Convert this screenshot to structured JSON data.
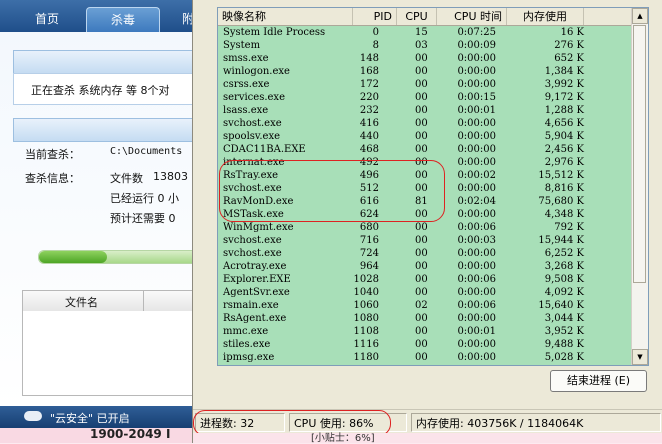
{
  "antivirus": {
    "tabs": [
      "首页",
      "杀毒",
      "附"
    ],
    "scan_status": "正在查杀  系统内存  等 8个对",
    "current_label": "当前查杀：",
    "current_value": "C:\\Documents",
    "info_label": "查杀信息：",
    "files_label": "文件数",
    "files_value": "13803",
    "elapsed": "已经运行 0 小",
    "remaining": "预计还需要 0",
    "progress": 0.42,
    "table_header": "文件名",
    "cloud": "\"云安全\" 已开启",
    "footer_left": "1900-2049 I"
  },
  "taskmgr": {
    "columns": [
      "映像名称",
      "PID",
      "CPU",
      "CPU 时间",
      "内存使用"
    ],
    "processes": [
      {
        "name": "System Idle Process",
        "pid": "0",
        "cpu": "15",
        "time": "0:07:25",
        "mem": "16 K"
      },
      {
        "name": "System",
        "pid": "8",
        "cpu": "03",
        "time": "0:00:09",
        "mem": "276 K"
      },
      {
        "name": "smss.exe",
        "pid": "148",
        "cpu": "00",
        "time": "0:00:00",
        "mem": "652 K"
      },
      {
        "name": "winlogon.exe",
        "pid": "168",
        "cpu": "00",
        "time": "0:00:00",
        "mem": "1,384 K"
      },
      {
        "name": "csrss.exe",
        "pid": "172",
        "cpu": "00",
        "time": "0:00:00",
        "mem": "3,992 K"
      },
      {
        "name": "services.exe",
        "pid": "220",
        "cpu": "00",
        "time": "0:00:15",
        "mem": "9,172 K"
      },
      {
        "name": "lsass.exe",
        "pid": "232",
        "cpu": "00",
        "time": "0:00:01",
        "mem": "1,288 K"
      },
      {
        "name": "svchost.exe",
        "pid": "416",
        "cpu": "00",
        "time": "0:00:00",
        "mem": "4,656 K"
      },
      {
        "name": "spoolsv.exe",
        "pid": "440",
        "cpu": "00",
        "time": "0:00:00",
        "mem": "5,904 K"
      },
      {
        "name": "CDAC11BA.EXE",
        "pid": "468",
        "cpu": "00",
        "time": "0:00:00",
        "mem": "2,456 K"
      },
      {
        "name": "internat.exe",
        "pid": "492",
        "cpu": "00",
        "time": "0:00:00",
        "mem": "2,976 K"
      },
      {
        "name": "RsTray.exe",
        "pid": "496",
        "cpu": "00",
        "time": "0:00:02",
        "mem": "15,512 K"
      },
      {
        "name": "svchost.exe",
        "pid": "512",
        "cpu": "00",
        "time": "0:00:00",
        "mem": "8,816 K"
      },
      {
        "name": "RavMonD.exe",
        "pid": "616",
        "cpu": "81",
        "time": "0:02:04",
        "mem": "75,680 K"
      },
      {
        "name": "MSTask.exe",
        "pid": "624",
        "cpu": "00",
        "time": "0:00:00",
        "mem": "4,348 K"
      },
      {
        "name": "WinMgmt.exe",
        "pid": "680",
        "cpu": "00",
        "time": "0:00:06",
        "mem": "792 K"
      },
      {
        "name": "svchost.exe",
        "pid": "716",
        "cpu": "00",
        "time": "0:00:03",
        "mem": "15,944 K"
      },
      {
        "name": "svchost.exe",
        "pid": "724",
        "cpu": "00",
        "time": "0:00:00",
        "mem": "6,252 K"
      },
      {
        "name": "Acrotray.exe",
        "pid": "964",
        "cpu": "00",
        "time": "0:00:00",
        "mem": "3,268 K"
      },
      {
        "name": "Explorer.EXE",
        "pid": "1028",
        "cpu": "00",
        "time": "0:00:06",
        "mem": "9,508 K"
      },
      {
        "name": "AgentSvr.exe",
        "pid": "1040",
        "cpu": "00",
        "time": "0:00:00",
        "mem": "4,092 K"
      },
      {
        "name": "rsmain.exe",
        "pid": "1060",
        "cpu": "02",
        "time": "0:00:06",
        "mem": "15,640 K"
      },
      {
        "name": "RsAgent.exe",
        "pid": "1080",
        "cpu": "00",
        "time": "0:00:00",
        "mem": "3,044 K"
      },
      {
        "name": "mmc.exe",
        "pid": "1108",
        "cpu": "00",
        "time": "0:00:01",
        "mem": "3,952 K"
      },
      {
        "name": "stiles.exe",
        "pid": "1116",
        "cpu": "00",
        "time": "0:00:00",
        "mem": "9,488 K"
      },
      {
        "name": "ipmsg.exe",
        "pid": "1180",
        "cpu": "00",
        "time": "0:00:00",
        "mem": "5,028 K"
      }
    ],
    "end_process_label": "结束进程 (E)",
    "status": {
      "processes": "进程数: 32",
      "cpu": "CPU 使用: 86%",
      "memory": "内存使用: 403756K / 1184064K"
    },
    "bottom_fragment": "[小贴士：6%]",
    "highlight_color": "#dd2222"
  }
}
